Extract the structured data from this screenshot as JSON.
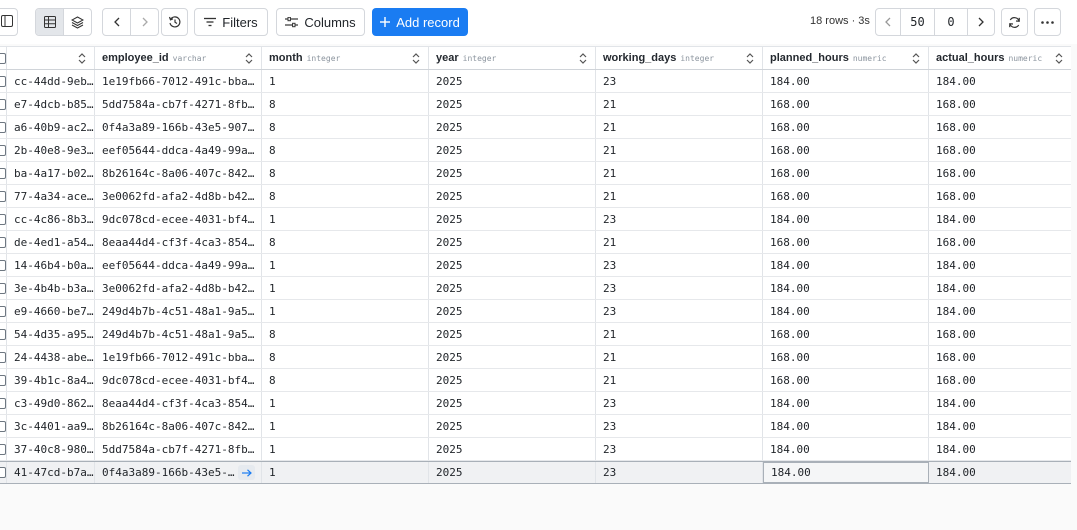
{
  "toolbar": {
    "filters_label": "Filters",
    "columns_label": "Columns",
    "add_record_label": "Add record",
    "rows_meta": "18 rows · 3s",
    "page_size": "50",
    "offset": "0"
  },
  "columns": [
    {
      "name": "",
      "type": ""
    },
    {
      "name": "employee_id",
      "type": "varchar"
    },
    {
      "name": "month",
      "type": "integer"
    },
    {
      "name": "year",
      "type": "integer"
    },
    {
      "name": "working_days",
      "type": "integer"
    },
    {
      "name": "planned_hours",
      "type": "numeric"
    },
    {
      "name": "actual_hours",
      "type": "numeric"
    }
  ],
  "rows": [
    [
      "cc-44dd-9eb…",
      "1e19fb66-7012-491c-bba…",
      "1",
      "2025",
      "23",
      "184.00",
      "184.00"
    ],
    [
      "e7-4dcb-b85…",
      "5dd7584a-cb7f-4271-8fb…",
      "8",
      "2025",
      "21",
      "168.00",
      "168.00"
    ],
    [
      "a6-40b9-ac2…",
      "0f4a3a89-166b-43e5-907…",
      "8",
      "2025",
      "21",
      "168.00",
      "168.00"
    ],
    [
      "2b-40e8-9e3…",
      "eef05644-ddca-4a49-99a…",
      "8",
      "2025",
      "21",
      "168.00",
      "168.00"
    ],
    [
      "ba-4a17-b02…",
      "8b26164c-8a06-407c-842…",
      "8",
      "2025",
      "21",
      "168.00",
      "168.00"
    ],
    [
      "77-4a34-ace…",
      "3e0062fd-afa2-4d8b-b42…",
      "8",
      "2025",
      "21",
      "168.00",
      "168.00"
    ],
    [
      "cc-4c86-8b3…",
      "9dc078cd-ecee-4031-bf4…",
      "1",
      "2025",
      "23",
      "184.00",
      "184.00"
    ],
    [
      "de-4ed1-a54…",
      "8eaa44d4-cf3f-4ca3-854…",
      "8",
      "2025",
      "21",
      "168.00",
      "168.00"
    ],
    [
      "14-46b4-b0a…",
      "eef05644-ddca-4a49-99a…",
      "1",
      "2025",
      "23",
      "184.00",
      "184.00"
    ],
    [
      "3e-4b4b-b3a…",
      "3e0062fd-afa2-4d8b-b42…",
      "1",
      "2025",
      "23",
      "184.00",
      "184.00"
    ],
    [
      "e9-4660-be7…",
      "249d4b7b-4c51-48a1-9a5…",
      "1",
      "2025",
      "23",
      "184.00",
      "184.00"
    ],
    [
      "54-4d35-a95…",
      "249d4b7b-4c51-48a1-9a5…",
      "8",
      "2025",
      "21",
      "168.00",
      "168.00"
    ],
    [
      "24-4438-abe…",
      "1e19fb66-7012-491c-bba…",
      "8",
      "2025",
      "21",
      "168.00",
      "168.00"
    ],
    [
      "39-4b1c-8a4…",
      "9dc078cd-ecee-4031-bf4…",
      "8",
      "2025",
      "21",
      "168.00",
      "168.00"
    ],
    [
      "c3-49d0-862…",
      "8eaa44d4-cf3f-4ca3-854…",
      "1",
      "2025",
      "23",
      "184.00",
      "184.00"
    ],
    [
      "3c-4401-aa9…",
      "8b26164c-8a06-407c-842…",
      "1",
      "2025",
      "23",
      "184.00",
      "184.00"
    ],
    [
      "37-40c8-980…",
      "5dd7584a-cb7f-4271-8fb…",
      "1",
      "2025",
      "23",
      "184.00",
      "184.00"
    ],
    [
      "41-47cd-b7a…",
      "0f4a3a89-166b-43e5-…",
      "1",
      "2025",
      "23",
      "184.00",
      "184.00"
    ]
  ],
  "selected_row": 17,
  "colors": {
    "accent": "#1a7cf2",
    "selected_row": "#f0f1f3"
  }
}
